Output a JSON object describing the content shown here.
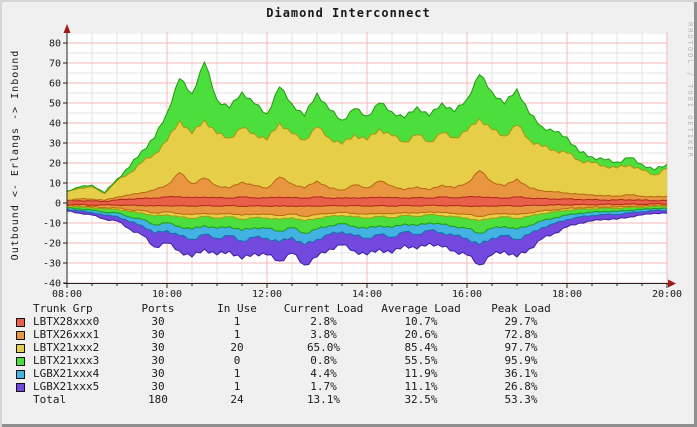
{
  "title": "Diamond Interconnect",
  "y_axis_label": "Outbound <- Erlangs -> Inbound",
  "watermark": "RRDTOOL / TOBI OETIKER",
  "chart_data": {
    "type": "area",
    "stacked": true,
    "units": "Erlangs",
    "ylim": [
      -40,
      80
    ],
    "y_tick_step": 10,
    "y_minor_step": 5,
    "x_hours": {
      "start": 8,
      "end": 20,
      "step": 0.25,
      "count": 49
    },
    "x_tick_labels": [
      "08:00",
      "10:00",
      "12:00",
      "14:00",
      "16:00",
      "18:00",
      "20:00"
    ],
    "x_tick_hours": [
      8,
      10,
      12,
      14,
      16,
      18,
      20
    ],
    "x_minor_step_hours": 0.5,
    "grid": true,
    "series": [
      {
        "name": "LBTX28xxx0",
        "color": "#e8604a",
        "outline": "#b02818",
        "inbound": [
          1.0,
          1.2,
          1.0,
          0.8,
          1.5,
          2.0,
          2.2,
          2.5,
          3.0,
          3.2,
          2.6,
          3.0,
          2.6,
          2.5,
          3.0,
          2.6,
          2.5,
          3.0,
          2.6,
          2.5,
          3.0,
          2.5,
          2.4,
          2.6,
          2.5,
          3.0,
          2.6,
          2.5,
          2.6,
          2.5,
          3.0,
          2.6,
          3.0,
          3.2,
          2.6,
          2.5,
          3.0,
          2.5,
          2.2,
          2.0,
          2.0,
          1.8,
          1.6,
          1.5,
          1.5,
          1.6,
          1.4,
          1.2,
          1.3
        ],
        "outbound": [
          0.8,
          0.8,
          1.0,
          1.0,
          1.0,
          1.2,
          1.2,
          1.5,
          1.3,
          1.5,
          1.5,
          1.4,
          1.5,
          1.4,
          1.6,
          1.5,
          1.5,
          1.6,
          1.5,
          1.7,
          1.5,
          1.4,
          1.3,
          1.4,
          1.5,
          1.4,
          1.5,
          1.3,
          1.4,
          1.2,
          1.3,
          1.4,
          1.5,
          1.7,
          1.5,
          1.4,
          1.5,
          1.3,
          1.1,
          1.0,
          0.9,
          0.8,
          0.8,
          0.7,
          0.7,
          0.6,
          0.6,
          0.5,
          0.5
        ]
      },
      {
        "name": "LBTX26xxx1",
        "color": "#e89740",
        "outline": "#b5680f",
        "inbound": [
          0.5,
          0.8,
          1.0,
          0.5,
          1.5,
          2.0,
          3.0,
          4.0,
          6.0,
          12.0,
          7.0,
          9.5,
          6.0,
          5.0,
          7.5,
          6.0,
          5.0,
          10.0,
          7.0,
          5.0,
          8.0,
          5.0,
          4.0,
          6.5,
          5.0,
          8.0,
          6.0,
          4.0,
          5.5,
          4.0,
          6.0,
          5.0,
          7.0,
          13.0,
          8.0,
          6.0,
          9.0,
          5.0,
          4.0,
          3.5,
          3.0,
          2.5,
          2.5,
          2.0,
          2.0,
          2.5,
          2.0,
          1.8,
          2.0
        ],
        "outbound": [
          0.6,
          0.8,
          1.0,
          1.4,
          1.5,
          2.2,
          2.6,
          3.5,
          3.2,
          3.8,
          4.3,
          3.7,
          4.2,
          3.8,
          4.5,
          4.0,
          4.2,
          4.6,
          4.0,
          5.0,
          4.3,
          3.7,
          3.4,
          3.8,
          4.2,
          3.7,
          4.0,
          3.4,
          3.7,
          3.2,
          3.5,
          3.8,
          4.2,
          5.0,
          4.2,
          3.8,
          4.3,
          3.7,
          2.9,
          2.4,
          1.9,
          1.6,
          1.4,
          1.3,
          1.3,
          1.1,
          1.0,
          0.8,
          0.8
        ]
      },
      {
        "name": "LBTX21xxx2",
        "color": "#e6ce48",
        "outline": "#a89810",
        "inbound": [
          4.0,
          5.5,
          6.0,
          3.5,
          8.0,
          11.0,
          15.0,
          18.0,
          22.0,
          26.0,
          25.0,
          29.0,
          26.0,
          25.0,
          27.0,
          26.0,
          24.0,
          27.0,
          25.0,
          24.0,
          27.0,
          25.0,
          23.0,
          25.0,
          24.0,
          26.0,
          25.0,
          24.0,
          26.0,
          24.0,
          26.0,
          25.0,
          26.0,
          26.0,
          26.0,
          25.0,
          27.0,
          24.0,
          22.0,
          21.0,
          20.0,
          17.0,
          16.0,
          15.0,
          14.0,
          15.0,
          13.0,
          11.0,
          14.0
        ],
        "outbound": [
          0.3,
          0.4,
          0.4,
          0.6,
          0.6,
          0.9,
          1.1,
          1.5,
          1.4,
          1.7,
          1.9,
          1.6,
          1.8,
          1.7,
          2.0,
          1.8,
          1.8,
          2.0,
          1.8,
          2.2,
          1.9,
          1.6,
          1.5,
          1.7,
          1.8,
          1.6,
          1.8,
          1.5,
          1.6,
          1.4,
          1.5,
          1.7,
          1.8,
          2.2,
          1.8,
          1.7,
          1.9,
          1.6,
          1.3,
          1.0,
          0.8,
          0.7,
          0.6,
          0.6,
          0.6,
          0.5,
          0.4,
          0.4,
          0.4
        ]
      },
      {
        "name": "LBTX21xxx3",
        "color": "#4cde3c",
        "outline": "#1f9a10",
        "inbound": [
          0.5,
          0.5,
          1.0,
          0.3,
          1.0,
          3.0,
          6.0,
          8.0,
          14.0,
          21.0,
          20.0,
          29.0,
          17.0,
          15.0,
          18.0,
          15.0,
          13.0,
          18.0,
          15.0,
          12.0,
          17.0,
          14.0,
          12.0,
          13.0,
          12.0,
          13.0,
          12.0,
          12.0,
          14.0,
          13.0,
          15.0,
          13.0,
          16.0,
          22.0,
          19.0,
          16.0,
          18.0,
          13.0,
          10.0,
          9.0,
          8.0,
          4.0,
          3.0,
          3.0,
          3.0,
          3.5,
          3.0,
          2.5,
          2.0
        ],
        "outbound": [
          0.8,
          1.0,
          1.2,
          1.6,
          1.8,
          2.6,
          3.2,
          4.4,
          4.0,
          4.8,
          5.4,
          4.6,
          5.2,
          4.8,
          5.6,
          5.0,
          5.2,
          5.8,
          5.0,
          6.2,
          5.4,
          4.6,
          4.2,
          4.8,
          5.2,
          4.6,
          5.0,
          4.2,
          4.6,
          4.0,
          4.4,
          4.8,
          5.2,
          6.2,
          5.2,
          4.8,
          5.4,
          4.6,
          3.6,
          3.0,
          2.4,
          2.0,
          1.8,
          1.6,
          1.6,
          1.4,
          1.2,
          1.0,
          1.0
        ]
      },
      {
        "name": "LGBX21xxx4",
        "color": "#42b2e2",
        "outline": "#1272a8",
        "outbound": [
          0.7,
          1.0,
          1.1,
          1.5,
          1.7,
          2.5,
          3.0,
          4.2,
          3.8,
          4.6,
          5.1,
          4.4,
          4.9,
          4.6,
          5.3,
          4.8,
          4.9,
          5.5,
          4.8,
          5.9,
          5.1,
          4.4,
          4.0,
          4.6,
          4.9,
          4.4,
          4.8,
          4.0,
          4.4,
          3.8,
          4.2,
          4.6,
          4.9,
          5.9,
          4.9,
          4.6,
          5.1,
          4.4,
          3.4,
          2.9,
          2.3,
          1.9,
          1.7,
          1.5,
          1.5,
          1.3,
          1.1,
          1.0,
          1.0
        ]
      },
      {
        "name": "LGBX21xxx5",
        "color": "#7248de",
        "outline": "#3d1f9e",
        "outbound": [
          0.8,
          1.1,
          1.3,
          2.0,
          2.4,
          3.6,
          4.9,
          6.9,
          6.3,
          7.6,
          8.8,
          7.3,
          8.4,
          7.7,
          9.0,
          8.0,
          8.4,
          9.5,
          8.0,
          10.0,
          8.8,
          7.3,
          6.6,
          7.7,
          8.4,
          7.3,
          8.0,
          6.6,
          7.3,
          6.4,
          7.1,
          7.7,
          8.4,
          10.0,
          8.4,
          7.7,
          8.8,
          7.3,
          5.7,
          4.8,
          3.7,
          3.0,
          2.7,
          2.4,
          2.4,
          2.1,
          1.7,
          1.4,
          1.4
        ]
      }
    ]
  },
  "legend_table": {
    "headers": [
      "Trunk Grp",
      "Ports",
      "In Use",
      "Current Load",
      "Average Load",
      "Peak Load"
    ],
    "rows": [
      {
        "trunk": "LBTX28xxx0",
        "ports": "30",
        "in_use": "1",
        "current": "2.8%",
        "average": "10.7%",
        "peak": "29.7%",
        "swatch": "#e8604a"
      },
      {
        "trunk": "LBTX26xxx1",
        "ports": "30",
        "in_use": "1",
        "current": "3.8%",
        "average": "20.6%",
        "peak": "72.8%",
        "swatch": "#e89740"
      },
      {
        "trunk": "LBTX21xxx2",
        "ports": "30",
        "in_use": "20",
        "current": "65.0%",
        "average": "85.4%",
        "peak": "97.7%",
        "swatch": "#e6ce48"
      },
      {
        "trunk": "LBTX21xxx3",
        "ports": "30",
        "in_use": "0",
        "current": "0.8%",
        "average": "55.5%",
        "peak": "95.9%",
        "swatch": "#4cde3c"
      },
      {
        "trunk": "LGBX21xxx4",
        "ports": "30",
        "in_use": "1",
        "current": "4.4%",
        "average": "11.9%",
        "peak": "36.1%",
        "swatch": "#42b2e2"
      },
      {
        "trunk": "LGBX21xxx5",
        "ports": "30",
        "in_use": "1",
        "current": "1.7%",
        "average": "11.1%",
        "peak": "26.8%",
        "swatch": "#7248de"
      },
      {
        "trunk": "Total",
        "ports": "180",
        "in_use": "24",
        "current": "13.1%",
        "average": "32.5%",
        "peak": "53.3%",
        "swatch": null
      }
    ]
  },
  "style_colors": {
    "figure_background": "#f0f0f0",
    "canvas_background": "#ffffff",
    "major_grid": "#f5b8b8",
    "minor_grid": "#e3e3e3",
    "axis": "#222222",
    "arrow": "#a01a1a"
  }
}
